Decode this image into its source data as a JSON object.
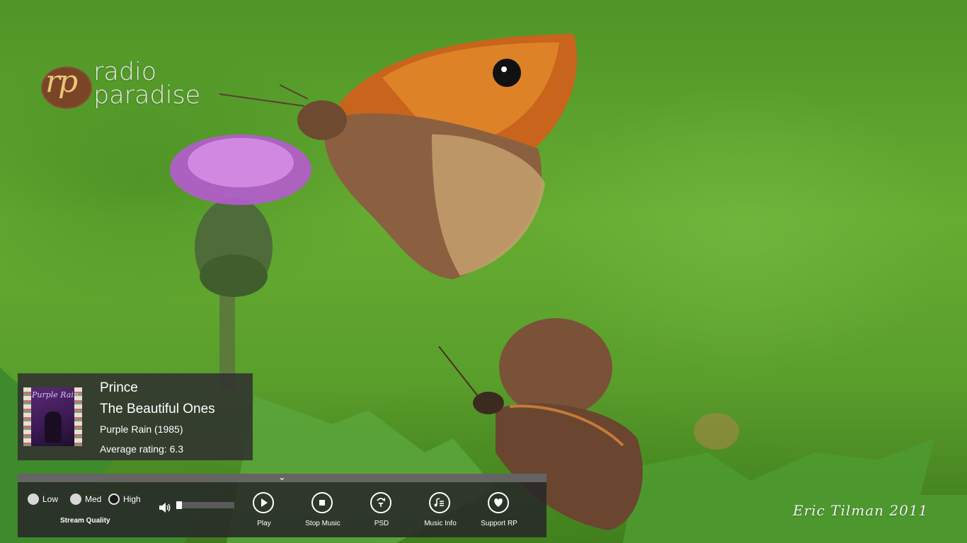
{
  "app": {
    "logo_mark": "rp",
    "logo_line1": "radio",
    "logo_line2": "paradise"
  },
  "now_playing": {
    "artist": "Prince",
    "title": "The Beautiful Ones",
    "album": "Purple Rain (1985)",
    "rating": "Average rating: 6.3",
    "album_art_text": "Purple Rain"
  },
  "quality": {
    "caption": "Stream Quality",
    "options": [
      {
        "label": "Low",
        "selected": false
      },
      {
        "label": "Med",
        "selected": false
      },
      {
        "label": "High",
        "selected": true
      }
    ]
  },
  "volume": {
    "level": 0.05,
    "icon": "speaker-icon"
  },
  "buttons": [
    {
      "label": "Play",
      "icon": "play-icon"
    },
    {
      "label": "Stop Music",
      "icon": "stop-icon"
    },
    {
      "label": "PSD",
      "icon": "skip-psd-icon"
    },
    {
      "label": "Music Info",
      "icon": "music-info-icon"
    },
    {
      "label": "Support RP",
      "icon": "heart-icon"
    }
  ],
  "photo_credit": "Eric Tilman 2011",
  "colors": {
    "panel": "#303030",
    "text": "#ffffff",
    "logo_circle": "#7a4426",
    "logo_mark": "#e9c677"
  }
}
